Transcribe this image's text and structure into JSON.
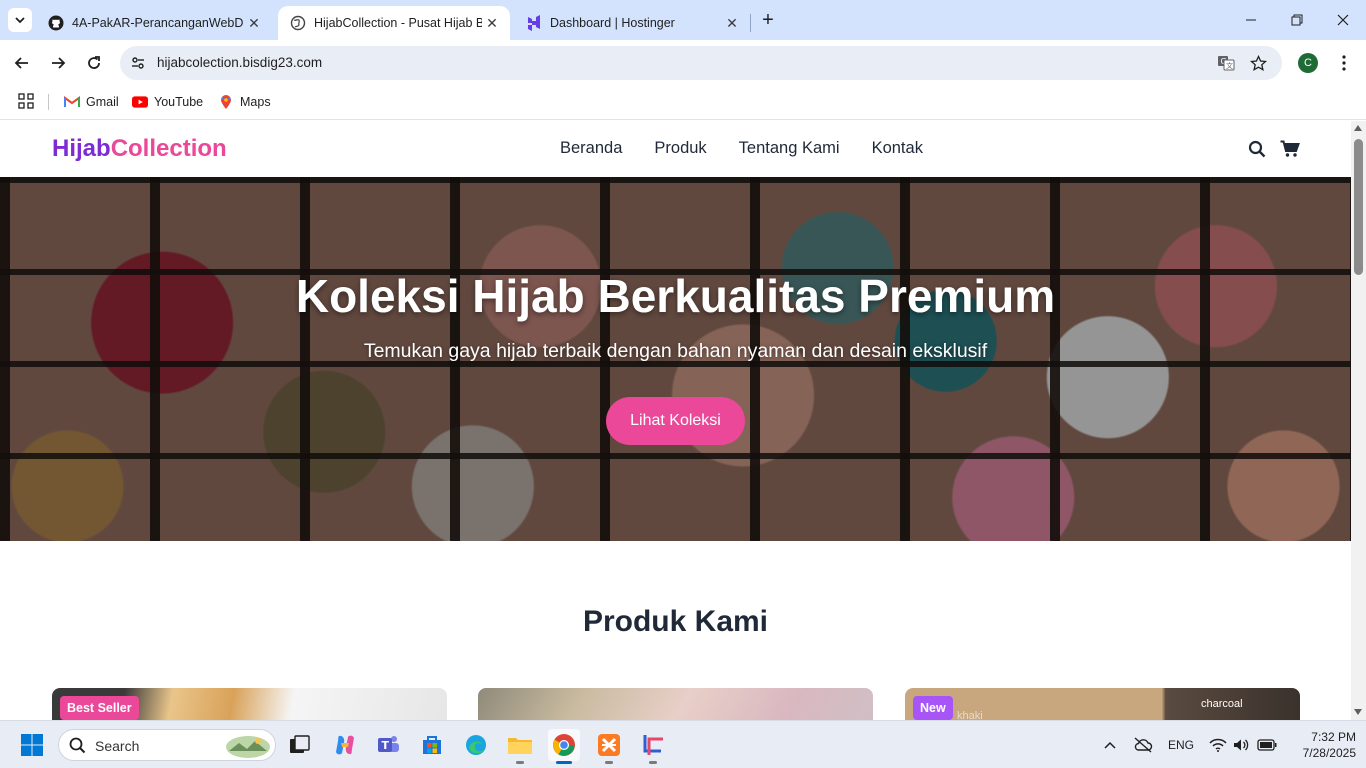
{
  "browser": {
    "tabs": [
      {
        "title": "4A-PakAR-PerancanganWebDa",
        "active": false,
        "icon": "github-icon"
      },
      {
        "title": "HijabCollection - Pusat Hijab Be",
        "active": true,
        "icon": "globe-icon"
      },
      {
        "title": "Dashboard | Hostinger",
        "active": false,
        "icon": "hostinger-icon"
      }
    ],
    "url": "hijabcolection.bisdig23.com",
    "profile_initial": "C",
    "bookmarks": [
      {
        "label": "Gmail",
        "icon": "gmail-icon"
      },
      {
        "label": "YouTube",
        "icon": "youtube-icon"
      },
      {
        "label": "Maps",
        "icon": "maps-icon"
      }
    ]
  },
  "site": {
    "logo_part1": "Hijab",
    "logo_part2": "Collection",
    "nav": [
      "Beranda",
      "Produk",
      "Tentang Kami",
      "Kontak"
    ],
    "hero": {
      "title": "Koleksi Hijab Berkualitas Premium",
      "subtitle": "Temukan gaya hijab terbaik dengan bahan nyaman dan desain eksklusif",
      "cta": "Lihat Koleksi"
    },
    "section_title": "Produk Kami",
    "cards": [
      {
        "badge": "Best Seller",
        "badge_color": "#ec4899"
      },
      {
        "badge": "",
        "badge_color": ""
      },
      {
        "badge": "New",
        "badge_color": "#a855f7",
        "color_labels": [
          "khaki",
          "charcoal"
        ]
      }
    ],
    "colors": {
      "brand_purple": "#7e2bd6",
      "brand_pink": "#ec4899"
    }
  },
  "taskbar": {
    "search_label": "Search",
    "language": "ENG",
    "time": "7:32 PM",
    "date": "7/28/2025"
  }
}
